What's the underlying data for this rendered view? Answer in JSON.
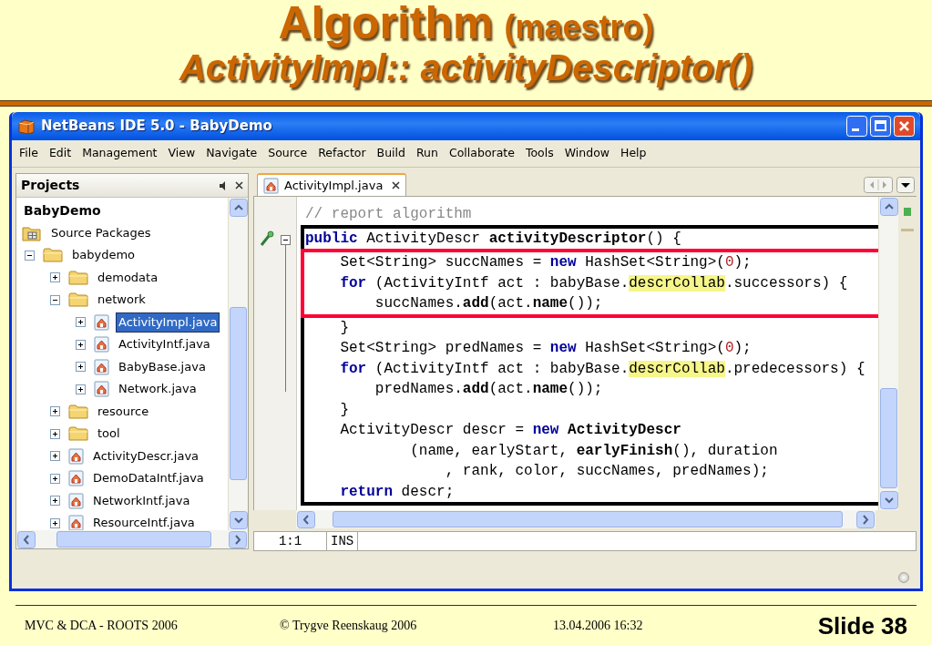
{
  "slide": {
    "title": "Algorithm",
    "title_aside": "(maestro)",
    "subtitle": "ActivityImpl:: activityDescriptor()",
    "footer": [
      "MVC & DCA -  ROOTS 2006",
      "© Trygve Reenskaug 2006",
      "13.04.2006 16:32"
    ],
    "slide_number": "Slide 38"
  },
  "window": {
    "title": "NetBeans IDE 5.0 - BabyDemo"
  },
  "menu": [
    "File",
    "Edit",
    "Management",
    "View",
    "Navigate",
    "Source",
    "Refactor",
    "Build",
    "Run",
    "Collaborate",
    "Tools",
    "Window",
    "Help"
  ],
  "projects_panel": {
    "title": "Projects",
    "tree": [
      {
        "label": "BabyDemo",
        "kind": "project",
        "selected": false,
        "children": [
          {
            "label": "Source Packages",
            "kind": "package-root",
            "selected": false,
            "children": [
              {
                "label": "babydemo",
                "kind": "folder",
                "expanded": true,
                "selected": false,
                "children": [
                  {
                    "label": "demodata",
                    "kind": "folder",
                    "expanded": false,
                    "selected": false
                  },
                  {
                    "label": "network",
                    "kind": "folder",
                    "expanded": true,
                    "selected": false,
                    "children": [
                      {
                        "label": "ActivityImpl.java",
                        "kind": "file",
                        "expanded": false,
                        "selected": true
                      },
                      {
                        "label": "ActivityIntf.java",
                        "kind": "file",
                        "expanded": false,
                        "selected": false
                      },
                      {
                        "label": "BabyBase.java",
                        "kind": "file",
                        "expanded": false,
                        "selected": false
                      },
                      {
                        "label": "Network.java",
                        "kind": "file",
                        "expanded": false,
                        "selected": false
                      }
                    ]
                  },
                  {
                    "label": "resource",
                    "kind": "folder",
                    "expanded": false,
                    "selected": false
                  },
                  {
                    "label": "tool",
                    "kind": "folder",
                    "expanded": false,
                    "selected": false
                  },
                  {
                    "label": "ActivityDescr.java",
                    "kind": "file",
                    "expanded": false,
                    "selected": false
                  },
                  {
                    "label": "DemoDataIntf.java",
                    "kind": "file",
                    "expanded": false,
                    "selected": false
                  },
                  {
                    "label": "NetworkIntf.java",
                    "kind": "file",
                    "expanded": false,
                    "selected": false
                  },
                  {
                    "label": "ResourceIntf.java",
                    "kind": "file",
                    "expanded": false,
                    "selected": false
                  }
                ]
              }
            ]
          }
        ]
      }
    ]
  },
  "editor": {
    "tab": "ActivityImpl.java",
    "code": [
      {
        "kind": "line",
        "tokens": [
          {
            "text": "// report algorithm",
            "kind": "comment"
          }
        ]
      },
      {
        "kind": "frame",
        "color": "#000000",
        "children": [
          {
            "kind": "line",
            "tokens": [
              {
                "text": "public",
                "kind": "keyword"
              },
              {
                "text": " ActivityDescr ",
                "kind": "plain"
              },
              {
                "text": "activityDescriptor",
                "kind": "bold"
              },
              {
                "text": "() {",
                "kind": "plain"
              }
            ]
          },
          {
            "kind": "frame",
            "color": "#ff0033",
            "children": [
              {
                "kind": "line",
                "tokens": [
                  {
                    "text": "    Set<String> succNames = ",
                    "kind": "plain"
                  },
                  {
                    "text": "new",
                    "kind": "keyword"
                  },
                  {
                    "text": " HashSet<String>(",
                    "kind": "plain"
                  },
                  {
                    "text": "0",
                    "kind": "number"
                  },
                  {
                    "text": ");",
                    "kind": "plain"
                  }
                ]
              },
              {
                "kind": "line",
                "tokens": [
                  {
                    "text": "    for",
                    "kind": "keyword"
                  },
                  {
                    "text": " (ActivityIntf act : babyBase.",
                    "kind": "plain"
                  },
                  {
                    "text": "descrCollab",
                    "kind": "highlight"
                  },
                  {
                    "text": ".successors) {",
                    "kind": "plain"
                  }
                ]
              },
              {
                "kind": "line",
                "tokens": [
                  {
                    "text": "        succNames.",
                    "kind": "plain"
                  },
                  {
                    "text": "add",
                    "kind": "bold"
                  },
                  {
                    "text": "(act.",
                    "kind": "plain"
                  },
                  {
                    "text": "name",
                    "kind": "bold"
                  },
                  {
                    "text": "());",
                    "kind": "plain"
                  }
                ]
              }
            ]
          },
          {
            "kind": "line",
            "tokens": [
              {
                "text": "    }",
                "kind": "plain"
              }
            ]
          },
          {
            "kind": "line",
            "tokens": [
              {
                "text": "    Set<String> predNames = ",
                "kind": "plain"
              },
              {
                "text": "new",
                "kind": "keyword"
              },
              {
                "text": " HashSet<String>(",
                "kind": "plain"
              },
              {
                "text": "0",
                "kind": "number"
              },
              {
                "text": ");",
                "kind": "plain"
              }
            ]
          },
          {
            "kind": "line",
            "tokens": [
              {
                "text": "    for",
                "kind": "keyword"
              },
              {
                "text": " (ActivityIntf act : babyBase.",
                "kind": "plain"
              },
              {
                "text": "descrCollab",
                "kind": "highlight"
              },
              {
                "text": ".predecessors) {",
                "kind": "plain"
              }
            ]
          },
          {
            "kind": "line",
            "tokens": [
              {
                "text": "        predNames.",
                "kind": "plain"
              },
              {
                "text": "add",
                "kind": "bold"
              },
              {
                "text": "(act.",
                "kind": "plain"
              },
              {
                "text": "name",
                "kind": "bold"
              },
              {
                "text": "());",
                "kind": "plain"
              }
            ]
          },
          {
            "kind": "line",
            "tokens": [
              {
                "text": "    }",
                "kind": "plain"
              }
            ]
          },
          {
            "kind": "line",
            "tokens": [
              {
                "text": "    ActivityDescr descr = ",
                "kind": "plain"
              },
              {
                "text": "new",
                "kind": "keyword"
              },
              {
                "text": " ActivityDescr",
                "kind": "bold"
              }
            ]
          },
          {
            "kind": "line",
            "tokens": [
              {
                "text": "            (name, earlyStart, ",
                "kind": "plain"
              },
              {
                "text": "earlyFinish",
                "kind": "bold"
              },
              {
                "text": "(), duration",
                "kind": "plain"
              }
            ]
          },
          {
            "kind": "line",
            "tokens": [
              {
                "text": "                , rank, color, succNames, predNames);",
                "kind": "plain"
              }
            ]
          },
          {
            "kind": "line",
            "tokens": [
              {
                "text": "    return",
                "kind": "keyword"
              },
              {
                "text": " descr;",
                "kind": "plain"
              }
            ]
          }
        ]
      }
    ]
  },
  "status_bar": {
    "position": "1:1",
    "mode": "INS"
  }
}
